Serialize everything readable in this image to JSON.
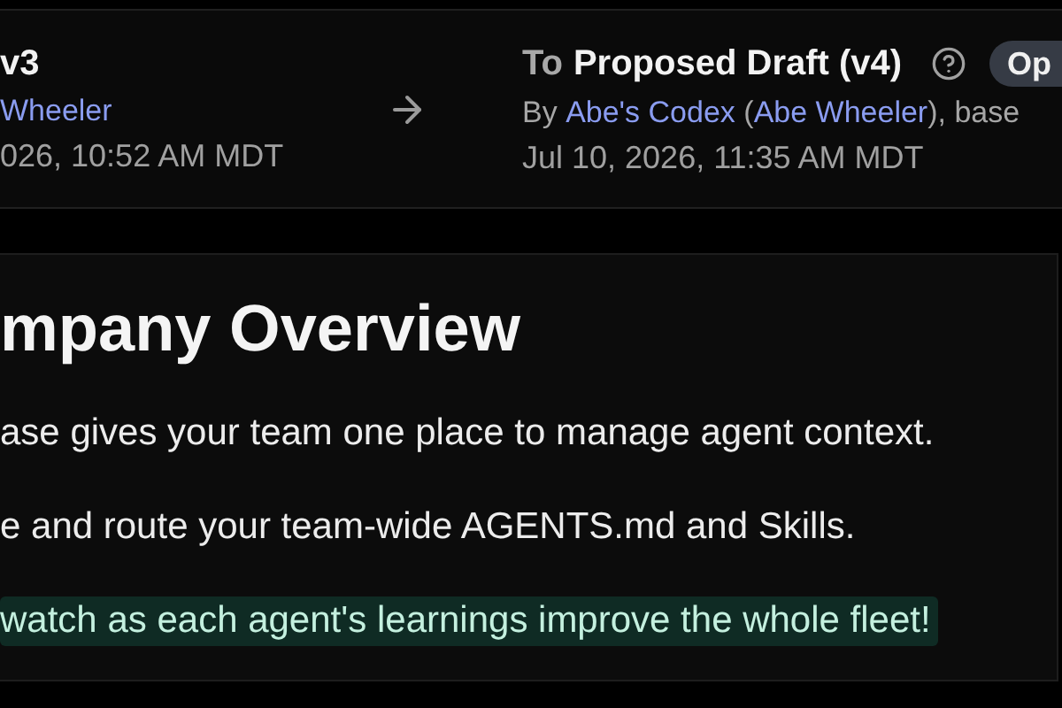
{
  "compare": {
    "from": {
      "title": "v3",
      "byline": [
        {
          "kind": "link",
          "text": "Wheeler"
        }
      ],
      "date": "026, 10:52 AM MDT"
    },
    "to": {
      "prefix": "To",
      "title": "Proposed Draft (v4)",
      "byline": [
        {
          "kind": "text",
          "text": "By "
        },
        {
          "kind": "link",
          "text": "Abe's Codex"
        },
        {
          "kind": "text",
          "text": " ("
        },
        {
          "kind": "link",
          "text": "Abe Wheeler"
        },
        {
          "kind": "text",
          "text": "), base"
        }
      ],
      "date": "Jul 10, 2026, 11:35 AM MDT",
      "button": "Op"
    }
  },
  "document": {
    "heading": "mpany Overview",
    "paragraphs": [
      {
        "text": "ase gives your team one place to manage agent context.",
        "highlighted": false
      },
      {
        "text": "e and route your team-wide AGENTS.md and Skills.",
        "highlighted": false
      },
      {
        "text": "watch as each agent's learnings improve the whole fleet!",
        "highlighted": true
      }
    ]
  }
}
